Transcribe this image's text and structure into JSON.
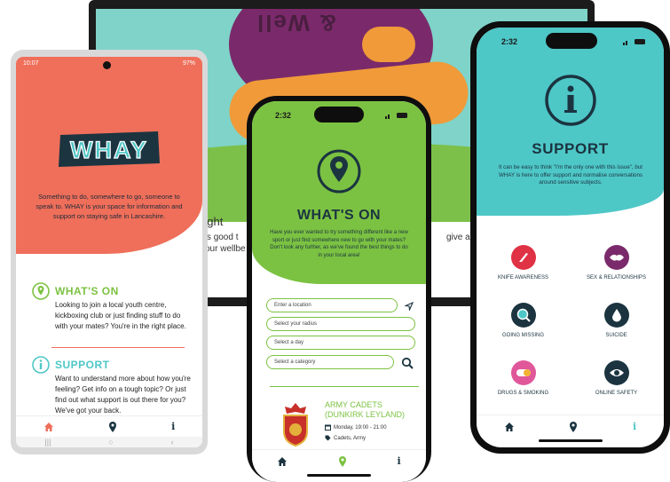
{
  "colors": {
    "coral": "#ef6f5a",
    "green": "#7cc242",
    "teal": "#4ec7c7",
    "navy": "#1b3440"
  },
  "laptop": {
    "banner_text": "& Well",
    "partial_heading": "ught",
    "partial_line1": "it's good t",
    "partial_line2": "your wellbe",
    "partial_right": "give a time"
  },
  "android": {
    "status_time": "10:07",
    "status_right": "97%",
    "logo_text": "WHAY",
    "intro": "Something to do, somewhere to go, someone to speak to. WHAY is your space for information and support on staying safe in Lancashire.",
    "whats_on": {
      "title": "WHAT'S ON",
      "body": "Looking to join a local youth centre, kickboxing club or just finding stuff to do with your mates? You're in the right place."
    },
    "support": {
      "title": "SUPPORT",
      "body": "Want to understand more about how you're feeling? Get info on a tough topic? Or just find out what support is out there for you? We've got your back."
    },
    "nav": {
      "home": "home-icon",
      "map": "location-icon",
      "info": "i"
    },
    "sys": {
      "recent": "|||",
      "home": "○",
      "back": "‹"
    }
  },
  "middle": {
    "status_time": "2:32",
    "title": "WHAT'S ON",
    "intro": "Have you ever wanted to try something different like a new sport or just find somewhere new to go with your mates? Don't look any further, as we've found the best things to do in your local area!",
    "fields": {
      "location": "Enter a location",
      "radius": "Select your radius",
      "day": "Select a day",
      "category": "Select a category"
    },
    "card": {
      "title": "ARMY CADETS (DUNKIRK LEYLAND)",
      "time": "Monday, 19:00 - 21:00",
      "tags": "Cadets, Army"
    }
  },
  "right": {
    "status_time": "2:32",
    "title": "SUPPORT",
    "intro": "It can be easy to think \"I'm the only one with this issue\", but WHAY is here to offer support and normalise conversations around sensitive subjects.",
    "topics": [
      {
        "label": "KNIFE AWARENESS",
        "icon": "knife-icon",
        "color": "#e03245"
      },
      {
        "label": "SEX & RELATIONSHIPS",
        "icon": "lips-icon",
        "color": "#7a2a6a"
      },
      {
        "label": "GOING MISSING",
        "icon": "magnifier-icon",
        "color": "#1b3440"
      },
      {
        "label": "SUICIDE",
        "icon": "drop-icon",
        "color": "#1b3440"
      },
      {
        "label": "DRUGS & SMOKING",
        "icon": "pill-icon",
        "color": "#e0579a"
      },
      {
        "label": "ONLINE SAFETY",
        "icon": "eye-icon",
        "color": "#1b3440"
      }
    ]
  }
}
